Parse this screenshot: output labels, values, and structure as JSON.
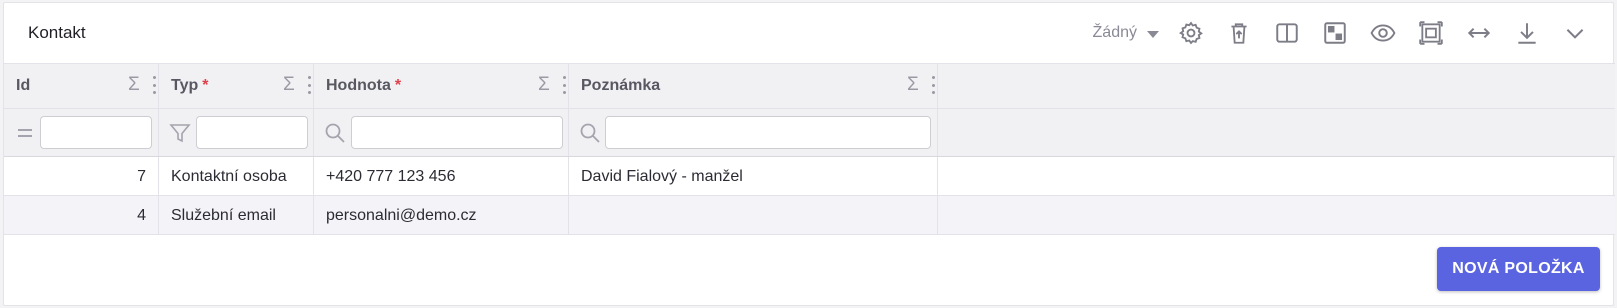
{
  "panel": {
    "title": "Kontakt"
  },
  "toolbar": {
    "view_selector_value": "Žádný",
    "icons": [
      "settings-icon",
      "delete-icon",
      "columns-icon",
      "density-icon",
      "visibility-icon",
      "fullscreen-icon",
      "fit-width-icon",
      "download-icon",
      "collapse-icon"
    ]
  },
  "table": {
    "columns": [
      {
        "label": "Id",
        "required": ""
      },
      {
        "label": "Typ",
        "required": "*"
      },
      {
        "label": "Hodnota",
        "required": "*"
      },
      {
        "label": "Poznámka",
        "required": ""
      }
    ],
    "sum_symbol": "Σ",
    "filters": [
      "",
      "",
      "",
      ""
    ],
    "rows": [
      {
        "id": "7",
        "typ": "Kontaktní osoba",
        "hodnota": "+420 777 123 456",
        "poznamka": "David Fialový - manžel"
      },
      {
        "id": "4",
        "typ": "Služební email",
        "hodnota": "personalni@demo.cz",
        "poznamka": ""
      }
    ]
  },
  "actions": {
    "add_label": "NOVÁ POLOŽKA"
  },
  "colors": {
    "accent": "#5a63e0",
    "required": "#e0404a",
    "header_bg": "#f1f1f4",
    "alt_row": "#f3f3f8"
  }
}
